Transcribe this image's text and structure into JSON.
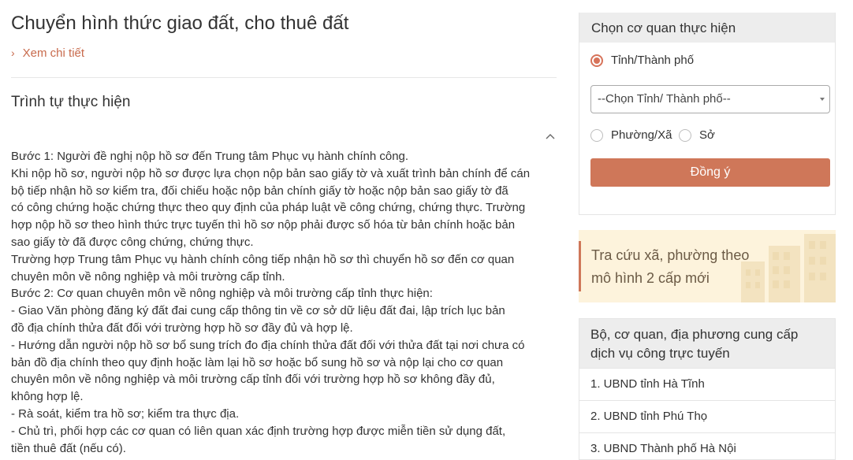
{
  "page": {
    "title": "Chuyển hình thức giao đất, cho thuê đất",
    "detail_link": "Xem chi tiết"
  },
  "procedure": {
    "section_title": "Trình tự thực hiện",
    "lines": [
      "Bước 1: Người đề nghị nộp hồ sơ đến Trung tâm Phục vụ hành chính công.",
      "Khi nộp hồ sơ, người nộp hồ sơ được lựa chọn nộp bản sao giấy tờ và xuất trình bản chính để cán",
      "bộ tiếp nhận hồ sơ kiểm tra, đối chiếu hoặc nộp bản chính giấy tờ hoặc nộp bản sao giấy tờ đã",
      "có công chứng hoặc chứng thực theo quy định của pháp luật về công chứng, chứng thực. Trường",
      "hợp nộp hồ sơ theo hình thức trực tuyến thì hồ sơ nộp phải được số hóa từ bản chính hoặc bản",
      "sao giấy tờ đã được công chứng, chứng thực.",
      "Trường hợp Trung tâm Phục vụ hành chính công tiếp nhận hồ sơ thì chuyển hồ sơ đến cơ quan",
      "chuyên môn về nông nghiệp và môi trường cấp tỉnh.",
      "Bước 2: Cơ quan chuyên môn về nông nghiệp và môi trường cấp tỉnh thực hiện:",
      "- Giao Văn phòng đăng ký đất đai cung cấp thông tin về cơ sở dữ liệu đất đai, lập trích lục bản",
      "đồ địa chính thửa đất đối với trường hợp hồ sơ đầy đủ và hợp lệ.",
      "- Hướng dẫn người nộp hồ sơ bổ sung trích đo địa chính thửa đất đối với thửa đất tại nơi chưa có",
      "bản đồ địa chính theo quy định hoặc làm lại hồ sơ hoặc bổ sung hồ sơ và nộp lại cho cơ quan",
      "chuyên môn về nông nghiệp và môi trường cấp tỉnh đối với trường hợp hồ sơ không đầy đủ,",
      "không hợp lệ.",
      "- Rà soát, kiểm tra hồ sơ; kiểm tra thực địa.",
      "- Chủ trì, phối hợp các cơ quan có liên quan xác định trường hợp được miễn tiền sử dụng đất,",
      "tiền thuê đất (nếu có)."
    ]
  },
  "agency_selector": {
    "header": "Chọn cơ quan thực hiện",
    "option_province": "Tỉnh/Thành phố",
    "option_ward": "Phường/Xã",
    "option_department": "Sở",
    "selected_option": "province",
    "select_value": "--Chọn Tỉnh/ Thành phố--",
    "submit_label": "Đồng ý"
  },
  "lookup_banner": {
    "line1": "Tra cứu xã, phường theo",
    "line2": "mô hình 2 cấp mới"
  },
  "providers": {
    "header": "Bộ, cơ quan, địa phương cung cấp dịch vụ công trực tuyến",
    "items": [
      "1. UBND tỉnh Hà Tĩnh",
      "2. UBND tỉnh Phú Thọ",
      "3. UBND Thành phố Hà Nội"
    ]
  },
  "colors": {
    "accent": "#cf7759",
    "link": "#c86b4d",
    "banner_bg": "#fdf3dc",
    "header_bg": "#ededed"
  }
}
